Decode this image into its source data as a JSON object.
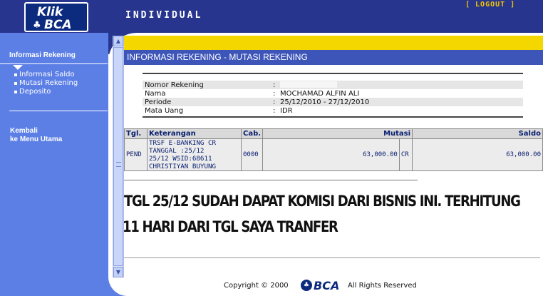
{
  "header": {
    "logo_top": "Klik",
    "logo_bottom": "BCA",
    "title": "INDIVIDUAL",
    "logout": "[ LOGOUT ]"
  },
  "sidebar": {
    "section_title": "Informasi Rekening",
    "items": [
      {
        "label": "Informasi Saldo"
      },
      {
        "label": "Mutasi Rekening"
      },
      {
        "label": "Deposito"
      }
    ],
    "back_line1": "Kembali",
    "back_line2": "ke Menu Utama"
  },
  "page": {
    "title": "INFORMASI REKENING - MUTASI REKENING"
  },
  "account": {
    "rows": [
      {
        "label": "Nomor Rekening",
        "sep": ":",
        "value": ""
      },
      {
        "label": "Nama",
        "sep": ":",
        "value": "MOCHAMAD ALFIN ALI"
      },
      {
        "label": "Periode",
        "sep": ":",
        "value": "25/12/2010 - 27/12/2010"
      },
      {
        "label": "Mata Uang",
        "sep": ":",
        "value": "IDR"
      }
    ]
  },
  "transactions": {
    "headers": {
      "tgl": "Tgl.",
      "keterangan": "Keterangan",
      "cab": "Cab.",
      "mutasi": "Mutasi",
      "saldo": "Saldo"
    },
    "rows": [
      {
        "tgl": "PEND",
        "keterangan": [
          "TRSF E-BANKING CR",
          "TANGGAL :25/12",
          "25/12 WSID:68611",
          "CHRISTIYAN BUYUNG"
        ],
        "cab": "0000",
        "mutasi": "63,000.00",
        "type": "CR",
        "saldo": "63,000.00"
      }
    ]
  },
  "annotation": {
    "line1": "TGL 25/12 SUDAH DAPAT KOMISI DARI BISNIS INI. TERHITUNG",
    "line2": "11 HARI DARI TGL SAYA TRANFER"
  },
  "footer": {
    "copyright": "Copyright © 2000",
    "brand": "BCA",
    "rights": "All Rights Reserved"
  },
  "colors": {
    "header_bg": "#27358f",
    "sidebar_bg": "#5c7fe6",
    "accent_yellow": "#f5d700",
    "title_bar": "#3d55b9",
    "logout": "#f5c400"
  }
}
